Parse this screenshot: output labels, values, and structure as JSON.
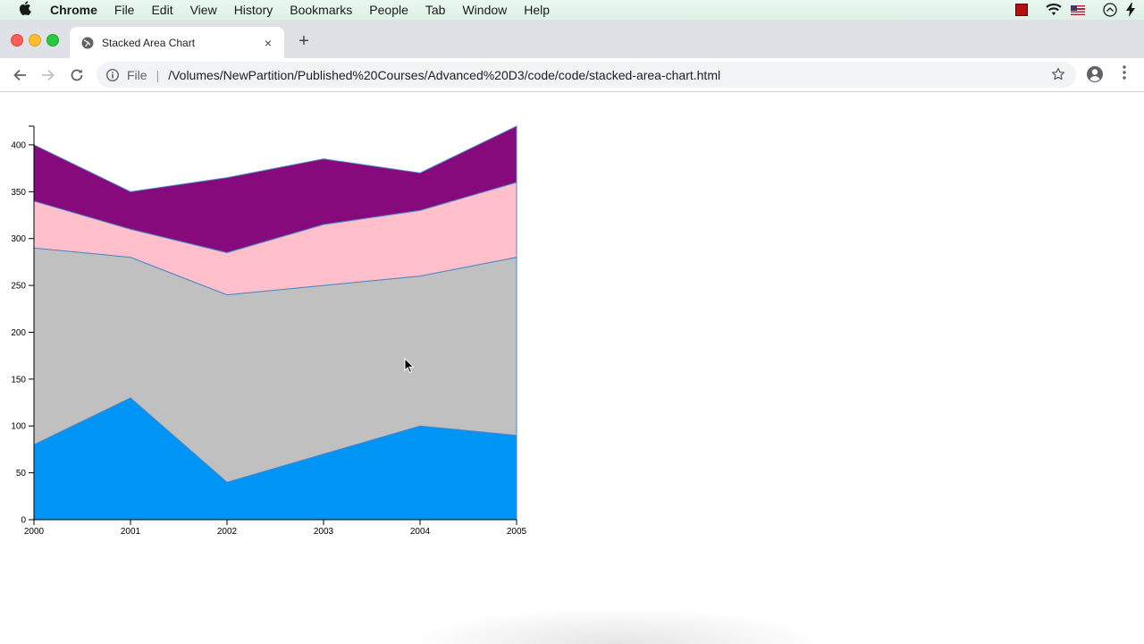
{
  "menubar": {
    "app": "Chrome",
    "items": [
      "File",
      "Edit",
      "View",
      "History",
      "Bookmarks",
      "People",
      "Tab",
      "Window",
      "Help"
    ]
  },
  "tab": {
    "title": "Stacked Area Chart",
    "close": "×"
  },
  "toolbar": {
    "scheme": "File",
    "separator": "|",
    "url": "/Volumes/NewPartition/Published%20Courses/Advanced%20D3/code/code/stacked-area-chart.html",
    "new_tab": "+"
  },
  "colors": {
    "layer1": "#0094f5",
    "layer2": "#c0c0c0",
    "layer3": "#ffbfcb",
    "layer4": "#870a7c",
    "stroke": "#4f86c6"
  },
  "chart_data": {
    "type": "area",
    "stacked": true,
    "x": [
      "2000",
      "2001",
      "2002",
      "2003",
      "2004",
      "2005"
    ],
    "series": [
      {
        "values": [
          80,
          130,
          40,
          70,
          100,
          90
        ]
      },
      {
        "values": [
          210,
          150,
          200,
          180,
          160,
          190
        ]
      },
      {
        "values": [
          50,
          30,
          45,
          65,
          70,
          80
        ]
      },
      {
        "values": [
          60,
          40,
          80,
          70,
          40,
          60
        ]
      }
    ],
    "yticks": [
      "0",
      "50",
      "100",
      "150",
      "200",
      "250",
      "300",
      "350",
      "400"
    ],
    "ylim": [
      0,
      420
    ],
    "title": "",
    "xlabel": "",
    "ylabel": ""
  }
}
